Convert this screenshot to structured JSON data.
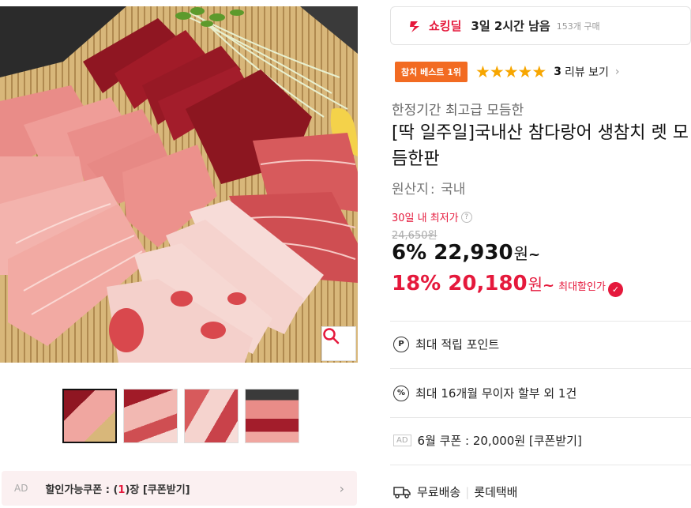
{
  "gallery": {
    "thumb_count": 4,
    "zoom_icon": "search-icon"
  },
  "coupon_bar": {
    "ad_label": "AD",
    "text_prefix": "할인가능쿠폰 : (",
    "count": "1",
    "text_suffix": ")장 [쿠폰받기]",
    "arrow": "›"
  },
  "deal": {
    "icon": "lightning-icon",
    "label": "쇼킹딜",
    "time_left": "3일 2시간 남음",
    "purchase_count": "153개 구매"
  },
  "rating": {
    "badge": "참치 베스트 1위",
    "stars": "★★★★★",
    "star_value": 5,
    "review_count": "3",
    "review_label": "리뷰 보기",
    "arrow": "›"
  },
  "product": {
    "subtitle": "한정기간 최고급 모듬한",
    "title": "[딱 일주일]국내산 참다랑어 생참치 렛 모듬한판",
    "origin_label": "원산지",
    "origin_value": "국내"
  },
  "pricing": {
    "lowest_label": "30일 내 최저가",
    "original_price": "24,650원",
    "discount1": "6%",
    "price1": "22,930",
    "won": "원",
    "tilde": "~",
    "discount2": "18%",
    "price2": "20,180",
    "max_discount_label": "최대할인가"
  },
  "benefits": {
    "points": "최대 적립 포인트",
    "installment": "최대 16개월 무이자 할부 외 1건",
    "coupon_ad": "AD",
    "coupon": "6월 쿠폰 : 20,000원 [쿠폰받기]",
    "shipping": "무료배송",
    "carrier": "롯데택배"
  },
  "colors": {
    "accent": "#e5193c",
    "badge_orange": "#f26b22",
    "star": "#f7a600"
  }
}
